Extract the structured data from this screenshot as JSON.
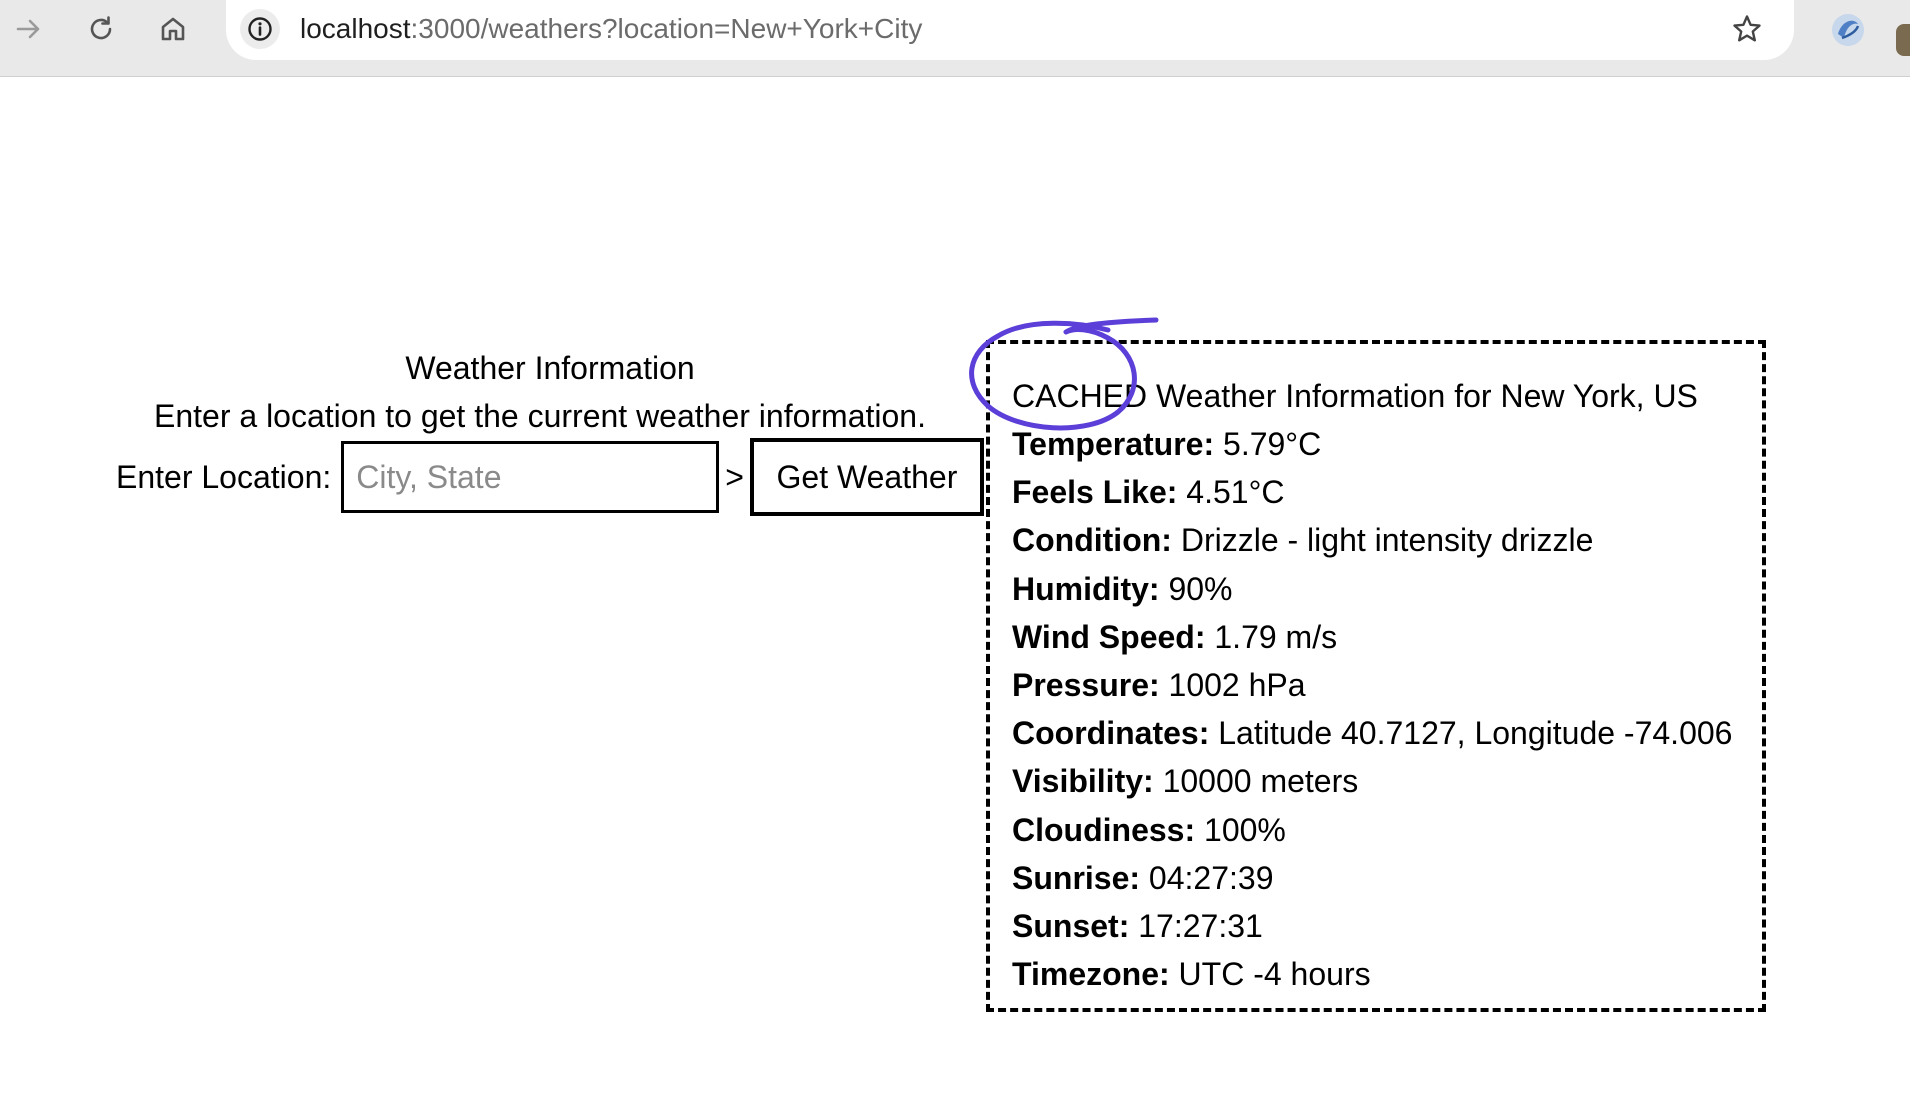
{
  "browser": {
    "url_host": "localhost",
    "url_path": ":3000/weathers?location=New+York+City"
  },
  "form": {
    "title": "Weather Information",
    "description": "Enter a location to get the current weather information.",
    "location_label": "Enter Location:",
    "location_placeholder": "City, State",
    "location_value": "",
    "separator": ">",
    "submit_label": "Get Weather"
  },
  "result": {
    "title": "CACHED Weather Information for New York, US",
    "rows": [
      {
        "label": "Temperature:",
        "value": " 5.79°C"
      },
      {
        "label": "Feels Like:",
        "value": " 4.51°C"
      },
      {
        "label": "Condition:",
        "value": " Drizzle - light intensity drizzle"
      },
      {
        "label": "Humidity:",
        "value": " 90%"
      },
      {
        "label": "Wind Speed:",
        "value": " 1.79 m/s"
      },
      {
        "label": "Pressure:",
        "value": " 1002 hPa"
      },
      {
        "label": "Coordinates:",
        "value": " Latitude 40.7127, Longitude -74.006"
      },
      {
        "label": "Visibility:",
        "value": " 10000 meters"
      },
      {
        "label": "Cloudiness:",
        "value": " 100%"
      },
      {
        "label": "Sunrise:",
        "value": " 04:27:39"
      },
      {
        "label": "Sunset:",
        "value": " 17:27:31"
      },
      {
        "label": "Timezone:",
        "value": " UTC -4 hours"
      }
    ]
  },
  "annotation": {
    "color": "#5b3fd8"
  }
}
